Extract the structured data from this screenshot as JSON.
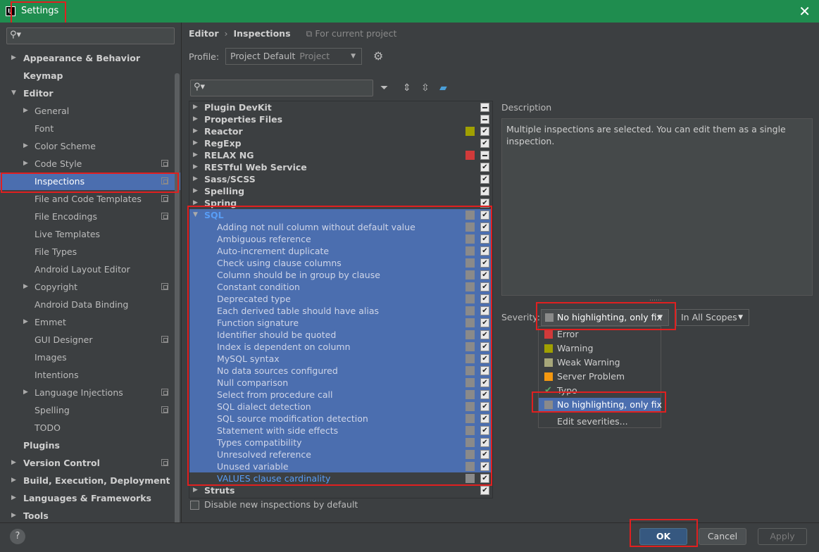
{
  "window": {
    "title": "Settings",
    "app_icon": "IJ"
  },
  "search": {
    "placeholder": ""
  },
  "sidebar": {
    "items": [
      {
        "label": "Appearance & Behavior",
        "level": 0,
        "arrow": "collapsed",
        "bold": true
      },
      {
        "label": "Keymap",
        "level": 0,
        "arrow": "",
        "bold": true
      },
      {
        "label": "Editor",
        "level": 0,
        "arrow": "expanded",
        "bold": true
      },
      {
        "label": "General",
        "level": 1,
        "arrow": "collapsed"
      },
      {
        "label": "Font",
        "level": 1,
        "arrow": ""
      },
      {
        "label": "Color Scheme",
        "level": 1,
        "arrow": "collapsed"
      },
      {
        "label": "Code Style",
        "level": 1,
        "arrow": "collapsed",
        "project": true
      },
      {
        "label": "Inspections",
        "level": 1,
        "arrow": "",
        "project": true,
        "selected": true
      },
      {
        "label": "File and Code Templates",
        "level": 1,
        "arrow": "",
        "project": true
      },
      {
        "label": "File Encodings",
        "level": 1,
        "arrow": "",
        "project": true
      },
      {
        "label": "Live Templates",
        "level": 1,
        "arrow": ""
      },
      {
        "label": "File Types",
        "level": 1,
        "arrow": ""
      },
      {
        "label": "Android Layout Editor",
        "level": 1,
        "arrow": ""
      },
      {
        "label": "Copyright",
        "level": 1,
        "arrow": "collapsed",
        "project": true
      },
      {
        "label": "Android Data Binding",
        "level": 1,
        "arrow": ""
      },
      {
        "label": "Emmet",
        "level": 1,
        "arrow": "collapsed"
      },
      {
        "label": "GUI Designer",
        "level": 1,
        "arrow": "",
        "project": true
      },
      {
        "label": "Images",
        "level": 1,
        "arrow": ""
      },
      {
        "label": "Intentions",
        "level": 1,
        "arrow": ""
      },
      {
        "label": "Language Injections",
        "level": 1,
        "arrow": "collapsed",
        "project": true
      },
      {
        "label": "Spelling",
        "level": 1,
        "arrow": "",
        "project": true
      },
      {
        "label": "TODO",
        "level": 1,
        "arrow": ""
      },
      {
        "label": "Plugins",
        "level": 0,
        "arrow": "",
        "bold": true
      },
      {
        "label": "Version Control",
        "level": 0,
        "arrow": "collapsed",
        "bold": true,
        "project": true
      },
      {
        "label": "Build, Execution, Deployment",
        "level": 0,
        "arrow": "collapsed",
        "bold": true
      },
      {
        "label": "Languages & Frameworks",
        "level": 0,
        "arrow": "collapsed",
        "bold": true
      },
      {
        "label": "Tools",
        "level": 0,
        "arrow": "collapsed",
        "bold": true
      }
    ]
  },
  "breadcrumb": {
    "section": "Editor",
    "separator": "›",
    "page": "Inspections",
    "note": "For current project"
  },
  "profile": {
    "label": "Profile:",
    "value": "Project Default",
    "scope_hint": "Project"
  },
  "inspections": [
    {
      "name": "Plugin DevKit",
      "type": "group",
      "check": "mixed"
    },
    {
      "name": "Properties Files",
      "type": "group",
      "check": "mixed"
    },
    {
      "name": "Reactor",
      "type": "group",
      "check": "checked",
      "sev_color": "#a0a000"
    },
    {
      "name": "RegExp",
      "type": "group",
      "check": "checked"
    },
    {
      "name": "RELAX NG",
      "type": "group",
      "check": "mixed",
      "sev_color": "#d13a3a"
    },
    {
      "name": "RESTful Web Service",
      "type": "group",
      "check": "checked"
    },
    {
      "name": "Sass/SCSS",
      "type": "group",
      "check": "checked"
    },
    {
      "name": "Spelling",
      "type": "group",
      "check": "checked"
    },
    {
      "name": "Spring",
      "type": "group",
      "check": "checked"
    },
    {
      "name": "SQL",
      "type": "sqlhead",
      "check": "checked",
      "sev_color": "#8a8a8a",
      "expanded": true
    },
    {
      "name": "Adding not null column without default value",
      "type": "child",
      "check": "checked"
    },
    {
      "name": "Ambiguous reference",
      "type": "child",
      "check": "checked"
    },
    {
      "name": "Auto-increment duplicate",
      "type": "child",
      "check": "checked"
    },
    {
      "name": "Check using clause columns",
      "type": "child",
      "check": "checked"
    },
    {
      "name": "Column should be in group by clause",
      "type": "child",
      "check": "checked"
    },
    {
      "name": "Constant condition",
      "type": "child",
      "check": "checked"
    },
    {
      "name": "Deprecated type",
      "type": "child",
      "check": "checked"
    },
    {
      "name": "Each derived table should have alias",
      "type": "child",
      "check": "checked"
    },
    {
      "name": "Function signature",
      "type": "child",
      "check": "checked"
    },
    {
      "name": "Identifier should be quoted",
      "type": "child",
      "check": "checked"
    },
    {
      "name": "Index is dependent on column",
      "type": "child",
      "check": "checked"
    },
    {
      "name": "MySQL syntax",
      "type": "child",
      "check": "checked"
    },
    {
      "name": "No data sources configured",
      "type": "child",
      "check": "checked"
    },
    {
      "name": "Null comparison",
      "type": "child",
      "check": "checked"
    },
    {
      "name": "Select from procedure call",
      "type": "child",
      "check": "checked"
    },
    {
      "name": "SQL dialect detection",
      "type": "child",
      "check": "checked"
    },
    {
      "name": "SQL source modification detection",
      "type": "child",
      "check": "checked"
    },
    {
      "name": "Statement with side effects",
      "type": "child",
      "check": "checked"
    },
    {
      "name": "Types compatibility",
      "type": "child",
      "check": "checked"
    },
    {
      "name": "Unresolved reference",
      "type": "child",
      "check": "checked"
    },
    {
      "name": "Unused variable",
      "type": "child",
      "check": "checked"
    },
    {
      "name": "VALUES clause cardinality",
      "type": "last",
      "check": "checked"
    },
    {
      "name": "Struts",
      "type": "group",
      "check": "checked"
    }
  ],
  "disable_new": {
    "label": "Disable new inspections by default"
  },
  "description": {
    "title": "Description",
    "text": "Multiple inspections are selected. You can edit them as a single inspection."
  },
  "severity": {
    "label": "Severity:",
    "value": "No highlighting, only fix",
    "scope": "In All Scopes",
    "options": [
      {
        "label": "Error",
        "color": "#d13a3a"
      },
      {
        "label": "Warning",
        "color": "#a0a000"
      },
      {
        "label": "Weak Warning",
        "color": "#a7a77a"
      },
      {
        "label": "Server Problem",
        "color": "#f49810"
      },
      {
        "label": "Typo",
        "color": "",
        "tick": "✔"
      },
      {
        "label": "No highlighting, only fix",
        "color": "#8a8a8a",
        "selected": true
      },
      {
        "label": "Edit severities...",
        "color": ""
      }
    ]
  },
  "buttons": {
    "help": "?",
    "ok": "OK",
    "cancel": "Cancel",
    "apply": "Apply"
  },
  "colors": {
    "selection": "#4b6eaf",
    "accent_red": "#e02020",
    "titlebar": "#1f8d4f"
  }
}
